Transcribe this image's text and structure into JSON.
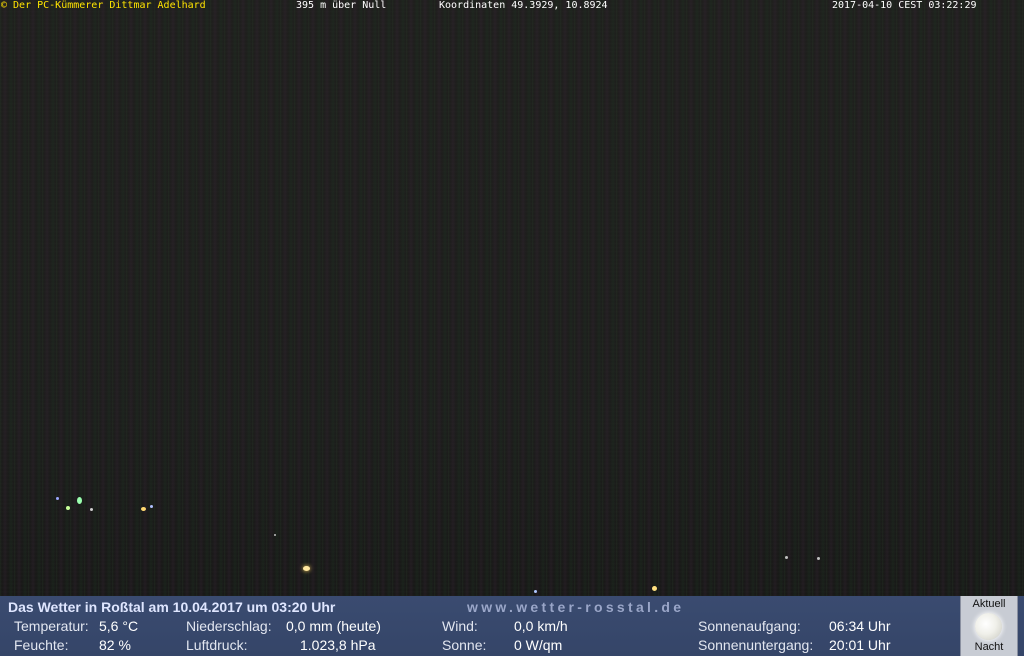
{
  "overlay": {
    "copyright": "© Der PC-Kümmerer Dittmar Adelhard",
    "altitude": "395 m über Null",
    "coordinates": "Koordinaten 49.3929, 10.8924",
    "timestamp": "2017-04-10 CEST 03:22:29"
  },
  "panel": {
    "headline": "Das Wetter in Roßtal am 10.04.2017 um 03:20 Uhr",
    "site": "www.wetter-rosstal.de",
    "temperature_label": "Temperatur:",
    "temperature_value": "5,6 °C",
    "humidity_label": "Feuchte:",
    "humidity_value": "82 %",
    "precip_label": "Niederschlag:",
    "precip_value": "0,0 mm (heute)",
    "pressure_label": "Luftdruck:",
    "pressure_value": "1.023,8 hPa",
    "wind_label": "Wind:",
    "wind_value": "0,0 km/h",
    "sun_label": "Sonne:",
    "sun_value": "0 W/qm",
    "sunrise_label": "Sonnenaufgang:",
    "sunrise_value": "06:34 Uhr",
    "sunset_label": "Sonnenuntergang:",
    "sunset_value": "20:01 Uhr",
    "status_top": "Aktuell",
    "status_bottom": "Nacht"
  },
  "colors": {
    "overlay_yellow": "#ffe400",
    "panel_bg": "#3a4b70",
    "site_text": "#9aa6c8"
  },
  "icons": {
    "moon": "full-moon-icon"
  }
}
